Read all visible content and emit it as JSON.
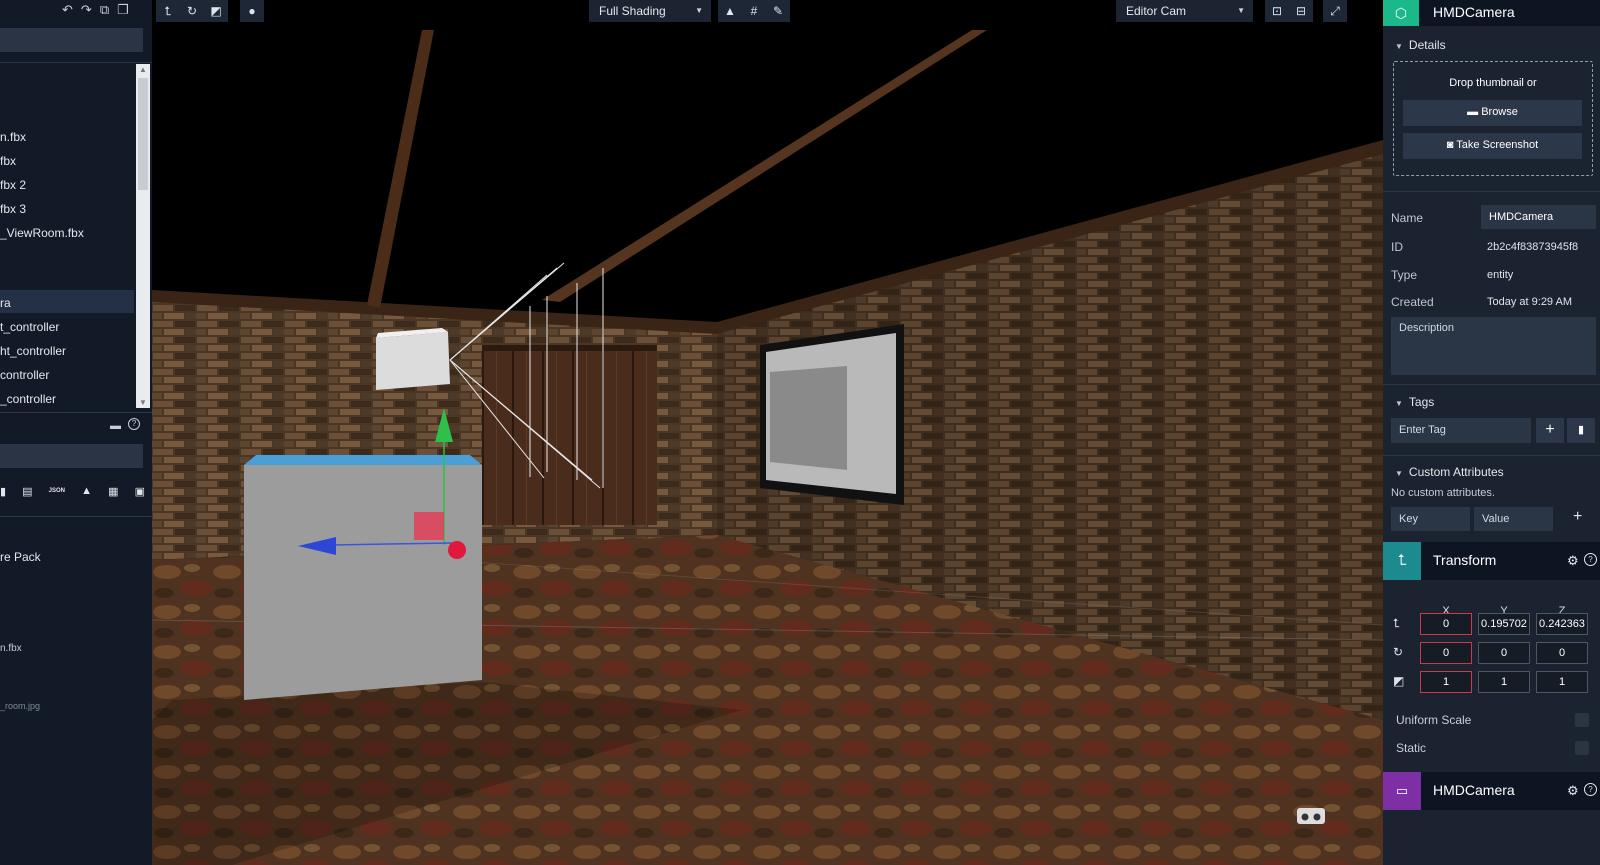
{
  "left_panel": {
    "tree_items": [
      "n.fbx",
      "fbx",
      "fbx 2",
      "fbx 3",
      "_ViewRoom.fbx",
      "ra",
      "t_controller",
      "ht_controller",
      "controller",
      "_controller"
    ],
    "selected_index": 5,
    "assets_items": [
      "re Pack",
      "n.fbx"
    ],
    "thumb_caption": "_room.jpg",
    "json_icon_label": "JSON"
  },
  "toolbar": {
    "shading_value": "Full Shading",
    "camera_value": "Editor Cam"
  },
  "inspector": {
    "entity_name": "HMDCamera",
    "details_label": "Details",
    "drop_text": "Drop thumbnail or",
    "browse_label": "Browse",
    "screenshot_label": "Take Screenshot",
    "name_label": "Name",
    "name_value": "HMDCamera",
    "id_label": "ID",
    "id_value": "2b2c4f83873945f8",
    "type_label": "Type",
    "type_value": "entity",
    "created_label": "Created",
    "created_value": "Today at 9:29 AM",
    "description_placeholder": "Description",
    "tags_label": "Tags",
    "tag_placeholder": "Enter Tag",
    "custom_label": "Custom Attributes",
    "no_custom": "No custom attributes.",
    "key_placeholder": "Key",
    "value_placeholder": "Value",
    "transform_label": "Transform",
    "axis_x": "X",
    "axis_y": "Y",
    "axis_z": "Z",
    "position": [
      "0",
      "0.195702",
      "0.242363"
    ],
    "rotation": [
      "0",
      "0",
      "0"
    ],
    "scale": [
      "1",
      "1",
      "1"
    ],
    "uniform_scale_label": "Uniform Scale",
    "static_label": "Static",
    "component_label": "HMDCamera"
  },
  "colors": {
    "accent_green": "#1bb98a",
    "transform_teal": "#1c8a8e",
    "hmd_purple": "#7e2fa6",
    "axis_red": "#c93a4c"
  }
}
